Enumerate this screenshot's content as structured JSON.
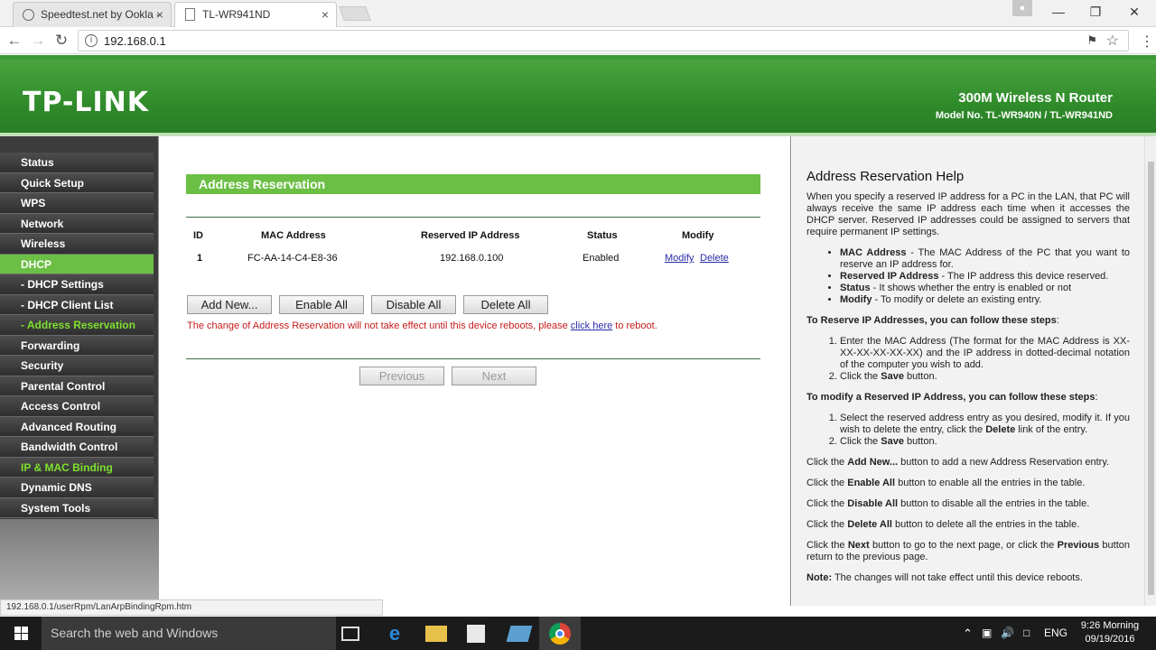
{
  "browser": {
    "tabs": [
      {
        "title": "Speedtest.net by Ookla -"
      },
      {
        "title": "TL-WR941ND"
      }
    ],
    "url": "192.168.0.1",
    "status_url": "192.168.0.1/userRpm/LanArpBindingRpm.htm"
  },
  "router": {
    "logo": "TP-LINK",
    "product": "300M Wireless N Router",
    "model": "Model No. TL-WR940N / TL-WR941ND"
  },
  "sidebar": {
    "items": [
      {
        "label": "Status"
      },
      {
        "label": "Quick Setup"
      },
      {
        "label": "WPS"
      },
      {
        "label": "Network"
      },
      {
        "label": "Wireless"
      },
      {
        "label": "DHCP"
      },
      {
        "label": "- DHCP Settings"
      },
      {
        "label": "- DHCP Client List"
      },
      {
        "label": "- Address Reservation"
      },
      {
        "label": "Forwarding"
      },
      {
        "label": "Security"
      },
      {
        "label": "Parental Control"
      },
      {
        "label": "Access Control"
      },
      {
        "label": "Advanced Routing"
      },
      {
        "label": "Bandwidth Control"
      },
      {
        "label": "IP & MAC Binding"
      },
      {
        "label": "Dynamic DNS"
      },
      {
        "label": "System Tools"
      }
    ]
  },
  "main": {
    "title": "Address Reservation",
    "columns": [
      "ID",
      "MAC Address",
      "Reserved IP Address",
      "Status",
      "Modify"
    ],
    "rows": [
      {
        "id": "1",
        "mac": "FC-AA-14-C4-E8-36",
        "ip": "192.168.0.100",
        "status": "Enabled",
        "modify": "Modify",
        "delete": "Delete"
      }
    ],
    "buttons": {
      "add_new": "Add New...",
      "enable_all": "Enable All",
      "disable_all": "Disable All",
      "delete_all": "Delete All",
      "previous": "Previous",
      "next": "Next"
    },
    "notice_before": "The change of Address Reservation will not take effect until this device reboots, please ",
    "notice_link": "click here",
    "notice_after": " to reboot."
  },
  "help": {
    "title": "Address Reservation Help",
    "intro": "When you specify a reserved IP address for a PC in the LAN, that PC will always receive the same IP address each time when it accesses the DHCP server. Reserved IP addresses could be assigned to servers that require permanent IP settings.",
    "bullets": [
      {
        "term": "MAC Address",
        "desc": " - The MAC Address of the PC that you want to reserve an IP address for."
      },
      {
        "term": "Reserved IP Address",
        "desc": " - The IP address this device reserved."
      },
      {
        "term": "Status",
        "desc": " - It shows whether the entry is enabled or not"
      },
      {
        "term": "Modify",
        "desc": " - To modify or delete an existing entry."
      }
    ],
    "reserve_heading": "To Reserve IP Addresses, you can follow these steps",
    "reserve_heading_suffix": ":",
    "reserve_step1": "Enter the MAC Address (The format for the MAC Address is XX-XX-XX-XX-XX-XX) and the IP address in dotted-decimal notation of the computer you wish to add.",
    "reserve_step2_pre": "Click the ",
    "reserve_step2_bold": "Save",
    "reserve_step2_post": " button.",
    "modify_heading": "To modify a Reserved IP Address, you can follow these steps",
    "modify_heading_suffix": ":",
    "modify_step1_pre": "Select the reserved address entry as you desired, modify it. If you wish to delete the entry, click the ",
    "modify_step1_bold": "Delete",
    "modify_step1_post": " link of the entry.",
    "modify_step2_pre": "Click the ",
    "modify_step2_bold": "Save",
    "modify_step2_post": " button.",
    "p_add_pre": "Click the ",
    "p_add_bold": "Add New...",
    "p_add_post": " button to add a new Address Reservation entry.",
    "p_enable_pre": "Click the ",
    "p_enable_bold": "Enable All",
    "p_enable_post": " button to enable all the entries in the table.",
    "p_disable_pre": "Click the ",
    "p_disable_bold": "Disable All",
    "p_disable_post": " button to disable all the entries in the table.",
    "p_delete_pre": "Click the ",
    "p_delete_bold": "Delete All",
    "p_delete_post": " button to delete all the entries in the table.",
    "p_next_pre": "Click the ",
    "p_next_bold": "Next",
    "p_next_mid": " button to go to the next page, or click the ",
    "p_next_bold2": "Previous",
    "p_next_post": " button return to the previous page.",
    "note_bold": "Note:",
    "note_text": " The changes will not take effect until this device reboots."
  },
  "taskbar": {
    "search_placeholder": "Search the web and Windows",
    "lang": "ENG",
    "time": "9:26 Morning",
    "date": "09/19/2016"
  },
  "colors": {
    "tp_green": "#6cbf45",
    "banner_green": "#2f8a2a",
    "notice_red": "#c41c1c",
    "link_blue": "#2a2aa8"
  }
}
